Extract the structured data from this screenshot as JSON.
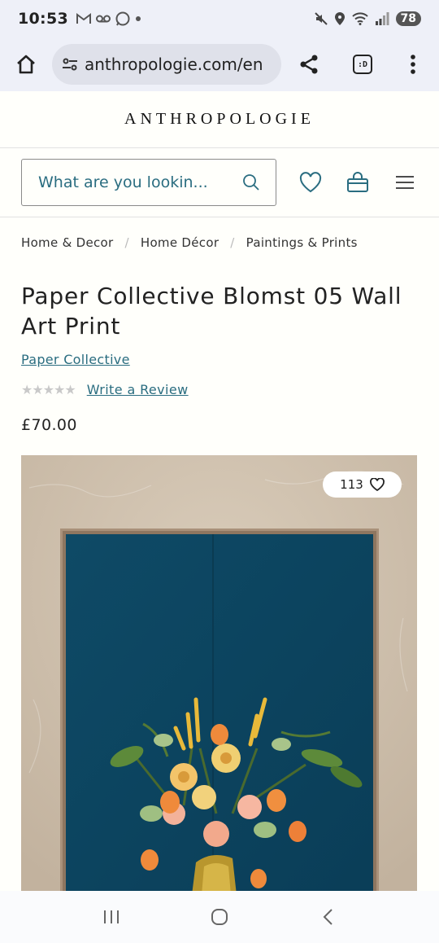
{
  "status_bar": {
    "time": "10:53",
    "battery": "78"
  },
  "browser": {
    "url": "anthropologie.com/en"
  },
  "site": {
    "logo": "ANTHROPOLOGIE",
    "search_placeholder": "What are you lookin..."
  },
  "breadcrumb": [
    "Home & Decor",
    "Home Décor",
    "Paintings & Prints"
  ],
  "breadcrumb_separator": "/",
  "product": {
    "title": "Paper Collective Blomst 05 Wall Art Print",
    "brand": "Paper Collective",
    "rating_stars": "★★★★★",
    "review_link": "Write a Review",
    "price": "£70.00",
    "like_count": "113"
  },
  "colors": {
    "accent": "#2a6d80",
    "wall": "#cfc0ad",
    "print_blue": "#0e4560"
  }
}
